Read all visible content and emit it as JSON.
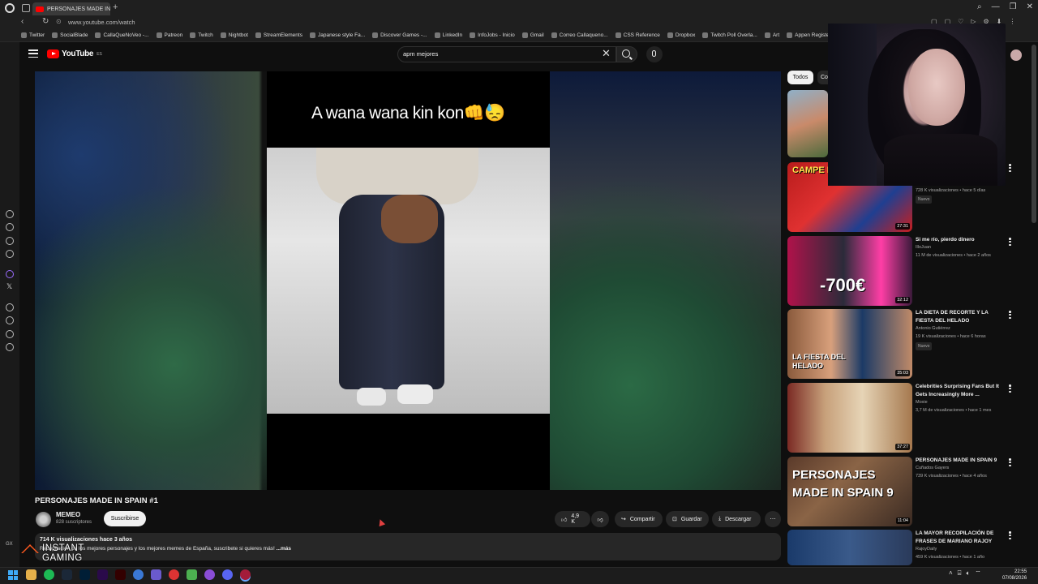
{
  "browser": {
    "tab_title": "PERSONAJES MADE IN...",
    "new_tab_symbol": "+",
    "url": "www.youtube.com/watch",
    "window_controls": [
      "⌕",
      "—",
      "❐",
      "✕"
    ],
    "bookmarks": [
      "Twitter",
      "SocialBlade",
      "CallaQueNoVeo -...",
      "Patreon",
      "Twitch",
      "Nightbot",
      "StreamElements",
      "Japanese style Fa...",
      "Discover Games -...",
      "LinkedIn",
      "InfoJobs - Inicio",
      "Gmail",
      "Correo Callaqueno...",
      "CSS Reference",
      "Dropbox",
      "Twitch Poll Overla...",
      "Art",
      "Appen Register"
    ]
  },
  "youtube": {
    "logo_text": "YouTube",
    "logo_region": "ES",
    "search_value": "apm mejores",
    "clear_symbol": "✕"
  },
  "video": {
    "caption": "A wana wana kin kon👊😓",
    "title": "PERSONAJES MADE IN SPAIN #1",
    "channel": "MEMEO",
    "subscribers": "828 suscriptores",
    "subscribe_label": "Suscribirse",
    "likes": "4,9 K",
    "share_label": "Compartir",
    "save_label": "Guardar",
    "download_label": "Descargar",
    "more_symbol": "⋯",
    "stats": "714 K visualizaciones  hace 3 años",
    "description": "Recopilación de los mejores personajes y los mejores memes de España, suscribete si quieres más!",
    "description_more": "...más"
  },
  "overlay": {
    "brand_top": "INSTANT",
    "brand_bottom": "GAMING"
  },
  "sidebar": {
    "chips": [
      "Todos",
      "Co"
    ],
    "videos": [
      {
        "title": "",
        "channel": "",
        "meta": "",
        "badge": "",
        "duration": "",
        "thumb_text": ""
      },
      {
        "title": "",
        "channel": "",
        "meta": "728 K visualizaciones • hace 5 días",
        "badge": "Nuevo",
        "duration": "27:31",
        "thumb_text": "CAMPE DEL M"
      },
      {
        "title": "Si me río, pierdo dinero",
        "channel": "IlloJuan",
        "meta": "11 M de visualizaciones • hace 2 años",
        "badge": "",
        "duration": "32:12",
        "thumb_text": "-700€"
      },
      {
        "title": "LA DIETA DE RECORTE Y LA FIESTA DEL HELADO",
        "channel": "Antonio Gutiérrez",
        "meta": "19 K visualizaciones • hace 6 horas",
        "badge": "Nuevo",
        "duration": "35:03",
        "thumb_text": "LA FIESTA DEL HELADO"
      },
      {
        "title": "Celebrities Surprising Fans But It Gets Increasingly More ...",
        "channel": "Moxie",
        "meta": "3,7 M de visualizaciones • hace 1 mes",
        "badge": "",
        "duration": "37:27",
        "thumb_text": ""
      },
      {
        "title": "PERSONAJES MADE IN SPAIN 9",
        "channel": "Cuñados Gayers",
        "meta": "739 K visualizaciones • hace 4 años",
        "badge": "",
        "duration": "11:04",
        "thumb_text": "PERSONAJES MADE IN SPAIN 9"
      },
      {
        "title": "LA MAYOR RECOPILACIÓN DE FRASES DE MARIANO RAJOY",
        "channel": "RajoyDaily",
        "meta": "459 K visualizaciones • hace 1 año",
        "badge": "",
        "duration": "",
        "thumb_text": ""
      }
    ]
  },
  "taskbar": {
    "time": "22:55",
    "date": "07/08/2026"
  },
  "colors": {
    "accent": "#ff0000",
    "background": "#0f0f0f",
    "chip_active": "#f1f1f1"
  }
}
